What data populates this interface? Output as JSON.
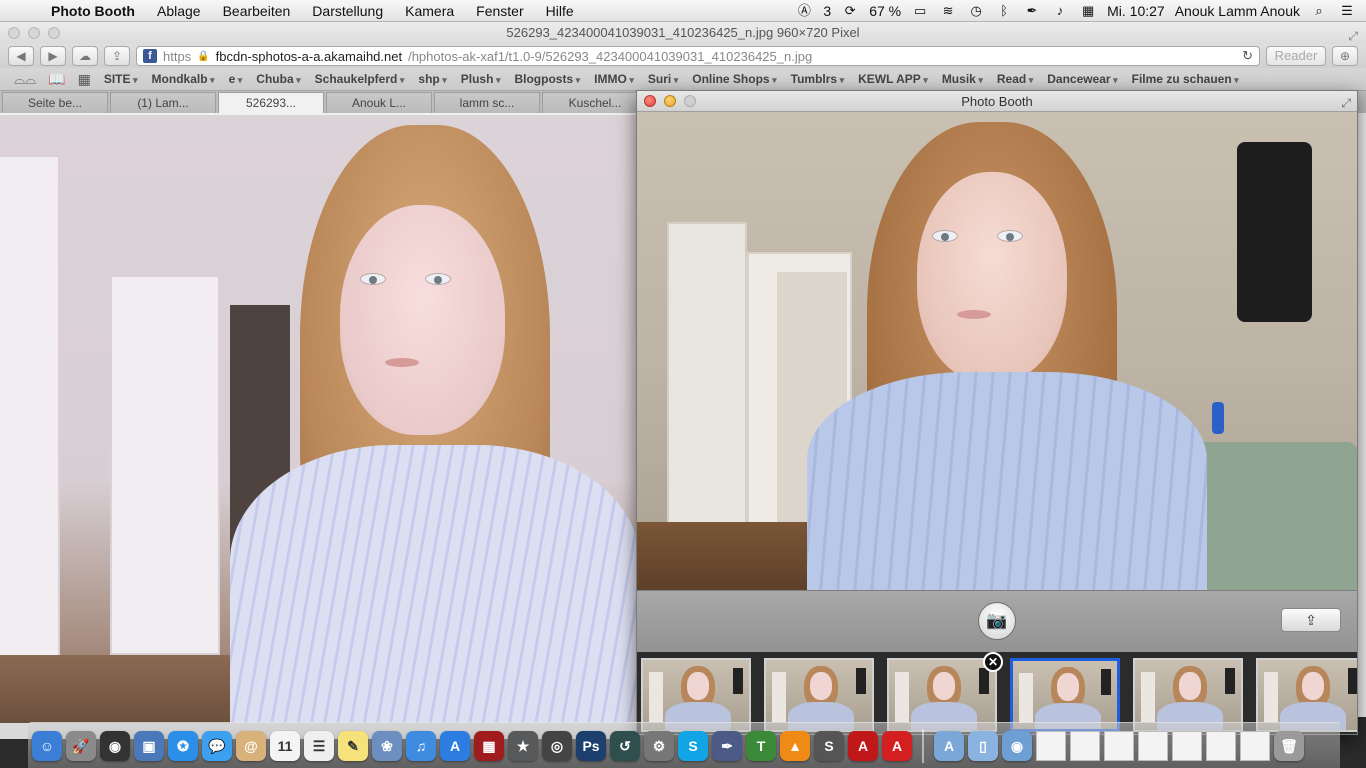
{
  "menubar": {
    "apple": "",
    "app_name": "Photo Booth",
    "menus": [
      "Ablage",
      "Bearbeiten",
      "Darstellung",
      "Kamera",
      "Fenster",
      "Hilfe"
    ],
    "tray": {
      "adobe_count": "3",
      "battery": "67 %",
      "datetime": "Mi. 10:27",
      "user": "Anouk Lamm Anouk"
    }
  },
  "safari": {
    "title": "526293_423400041039031_410236425_n.jpg 960×720 Pixel",
    "address": {
      "scheme": "https",
      "host": "fbcdn-sphotos-a-a.akamaihd.net",
      "path": "/hphotos-ak-xaf1/t1.0-9/526293_423400041039031_410236425_n.jpg"
    },
    "reader_label": "Reader",
    "bookmarks": [
      "SITE",
      "Mondkalb",
      "e",
      "Chuba",
      "Schaukelpferd",
      "shp",
      "Plush",
      "Blogposts",
      "IMMO",
      "Suri",
      "Online Shops",
      "Tumblrs",
      "KEWL APP",
      "Musik",
      "Read",
      "Dancewear",
      "Filme zu schauen"
    ],
    "tabs": [
      "Seite be...",
      "(1) Lam...",
      "526293...",
      "Anouk L...",
      "lamm sc...",
      "Kuschel..."
    ],
    "active_tab": 2
  },
  "photobooth": {
    "title": "Photo Booth",
    "thumbnail_count": 6,
    "selected_thumbnail": 3,
    "delete_glyph": "✕"
  },
  "dock": {
    "icons": [
      {
        "name": "finder",
        "color": "#3a7fd5",
        "glyph": "☺"
      },
      {
        "name": "launchpad",
        "color": "#8a8a8a",
        "glyph": "🚀"
      },
      {
        "name": "dashboard",
        "color": "#333333",
        "glyph": "◉"
      },
      {
        "name": "preview",
        "color": "#4a78b8",
        "glyph": "▣"
      },
      {
        "name": "safari",
        "color": "#2b8ee8",
        "glyph": "✪"
      },
      {
        "name": "messages",
        "color": "#3aa0ef",
        "glyph": "💬"
      },
      {
        "name": "mail",
        "color": "#d8b27a",
        "glyph": "@"
      },
      {
        "name": "calendar",
        "color": "#f4f4f4",
        "glyph": "11"
      },
      {
        "name": "reminders",
        "color": "#efefef",
        "glyph": "☰"
      },
      {
        "name": "notes",
        "color": "#f5e27a",
        "glyph": "✎"
      },
      {
        "name": "iphoto",
        "color": "#6c8fbf",
        "glyph": "❀"
      },
      {
        "name": "itunes",
        "color": "#3d8ce0",
        "glyph": "♫"
      },
      {
        "name": "app-store",
        "color": "#2d7de0",
        "glyph": "A"
      },
      {
        "name": "photo-booth",
        "color": "#a11d1d",
        "glyph": "▦"
      },
      {
        "name": "imovie",
        "color": "#58595b",
        "glyph": "★"
      },
      {
        "name": "aperture",
        "color": "#444444",
        "glyph": "◎"
      },
      {
        "name": "photoshop",
        "color": "#1c3f6d",
        "glyph": "Ps"
      },
      {
        "name": "time-machine",
        "color": "#2f4f4f",
        "glyph": "↺"
      },
      {
        "name": "system-preferences",
        "color": "#777777",
        "glyph": "⚙"
      },
      {
        "name": "skype",
        "color": "#12a5e6",
        "glyph": "S"
      },
      {
        "name": "pen-tool",
        "color": "#4b5a86",
        "glyph": "✒"
      },
      {
        "name": "tutor-for-pages",
        "color": "#3a8a3a",
        "glyph": "T"
      },
      {
        "name": "vlc",
        "color": "#f08a16",
        "glyph": "▲"
      },
      {
        "name": "scrivener",
        "color": "#555555",
        "glyph": "S"
      },
      {
        "name": "acrobat",
        "color": "#c01818",
        "glyph": "A"
      },
      {
        "name": "adobe-reader",
        "color": "#d31f1f",
        "glyph": "A"
      }
    ],
    "right_items": [
      {
        "name": "applications-folder",
        "color": "#7aa7d8",
        "glyph": "A"
      },
      {
        "name": "documents-folder",
        "color": "#8ab3e0",
        "glyph": "▯"
      },
      {
        "name": "downloads-folder",
        "color": "#6e9fd4",
        "glyph": "◉"
      }
    ],
    "doc_count": 7
  }
}
